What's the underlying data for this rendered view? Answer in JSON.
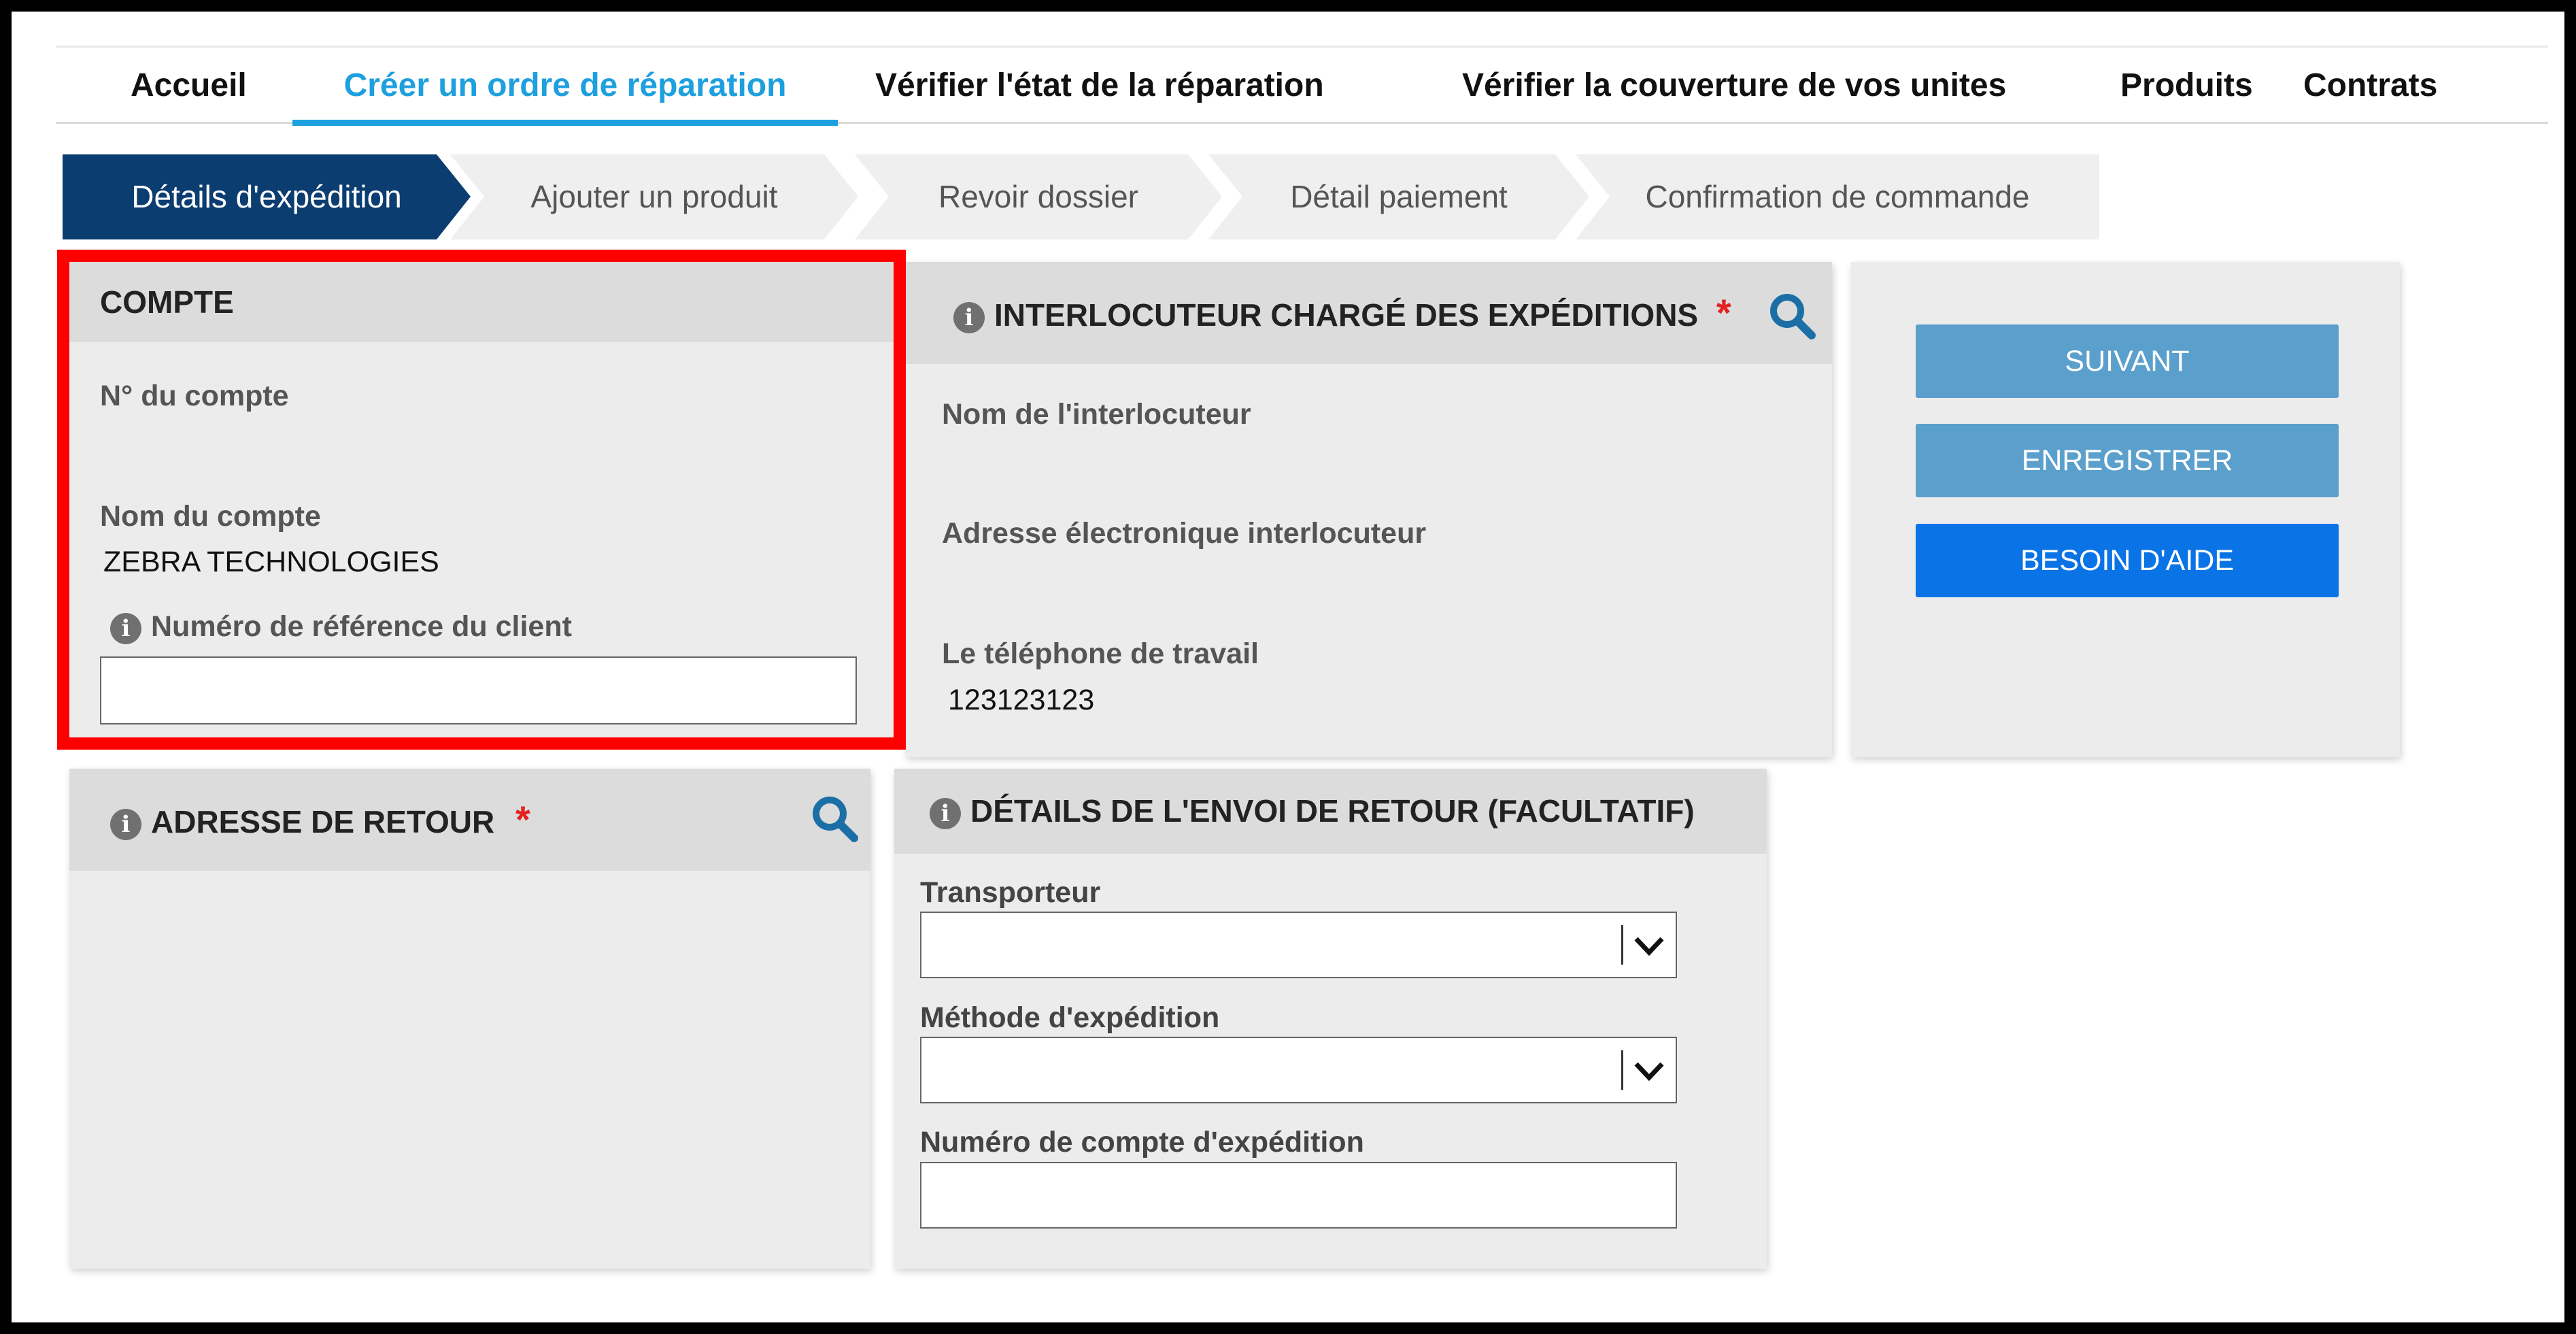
{
  "nav": {
    "items": [
      {
        "label": "Accueil"
      },
      {
        "label": "Créer un ordre de réparation"
      },
      {
        "label": "Vérifier l'état de la réparation"
      },
      {
        "label": "Vérifier la couverture de vos unites"
      },
      {
        "label": "Produits"
      },
      {
        "label": "Contrats"
      }
    ]
  },
  "steps": [
    {
      "label": "Détails d'expédition"
    },
    {
      "label": "Ajouter un produit"
    },
    {
      "label": "Revoir dossier"
    },
    {
      "label": "Détail paiement"
    },
    {
      "label": "Confirmation de commande"
    }
  ],
  "account": {
    "title": "COMPTE",
    "number_label": "N° du compte",
    "number_value": "",
    "name_label": "Nom du compte",
    "name_value": "ZEBRA TECHNOLOGIES",
    "ref_label": "Numéro de référence du client",
    "ref_value": ""
  },
  "contact": {
    "title": "INTERLOCUTEUR CHARGÉ DES EXPÉDITIONS",
    "required_mark": "*",
    "name_label": "Nom de l'interlocuteur",
    "email_label": "Adresse électronique interlocuteur",
    "phone_label": "Le téléphone de travail",
    "phone_value": "123123123"
  },
  "actions": {
    "next": "SUIVANT",
    "save": "ENREGISTRER",
    "help": "BESOIN D'AIDE"
  },
  "return_address": {
    "title": "ADRESSE DE RETOUR",
    "required_mark": "*"
  },
  "return_shipment": {
    "title": "DÉTAILS DE L'ENVOI DE RETOUR (FACULTATIF)",
    "carrier_label": "Transporteur",
    "method_label": "Méthode d'expédition",
    "account_label": "Numéro de compte d'expédition"
  },
  "colors": {
    "accent": "#1ea0df",
    "step_active": "#0b3d71",
    "step_inactive": "#efefef",
    "btn_muted": "#5ba0cc",
    "btn_primary": "#0a73e6",
    "highlight": "#ff0000",
    "required": "#e52020"
  },
  "icons": {
    "info": "info-icon",
    "search": "search-icon",
    "chevron": "chevron-down-icon"
  }
}
